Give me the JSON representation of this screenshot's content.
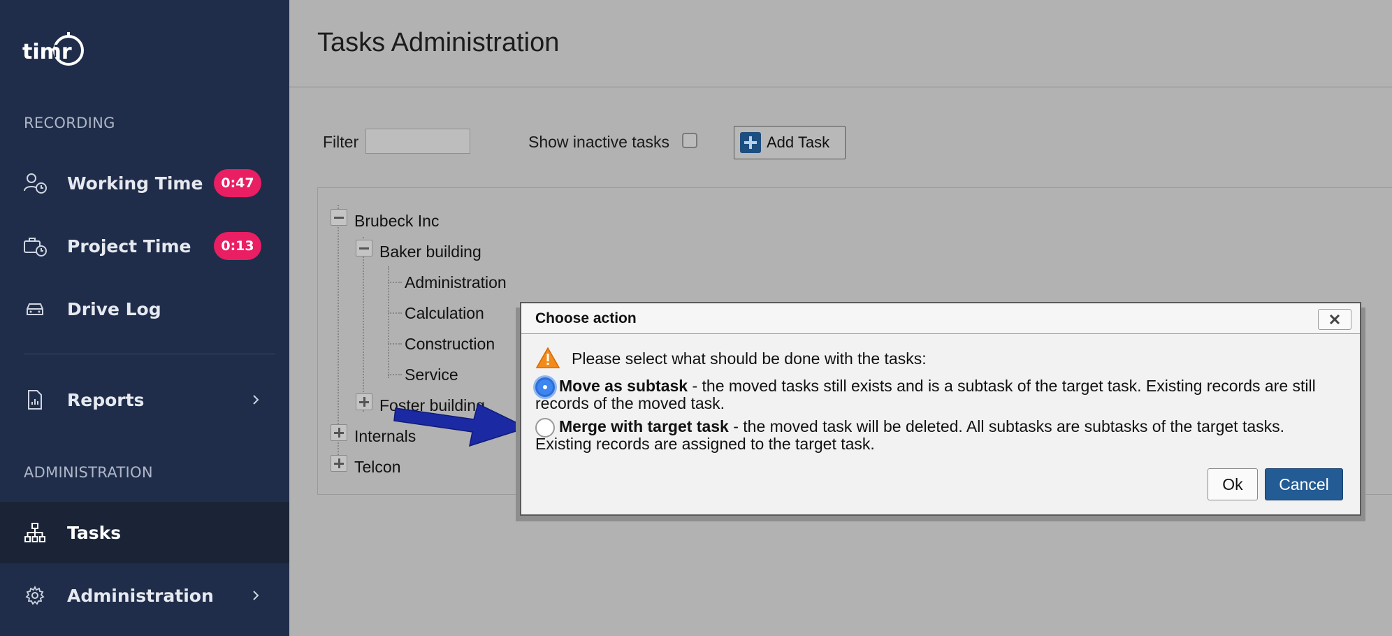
{
  "app": {
    "logo_text": "timr"
  },
  "sidebar": {
    "sections": {
      "recording": "RECORDING",
      "administration": "ADMINISTRATION"
    },
    "items": [
      {
        "label": "Working Time",
        "badge": "0:47",
        "icon": "user-clock-icon"
      },
      {
        "label": "Project Time",
        "badge": "0:13",
        "icon": "briefcase-clock-icon"
      },
      {
        "label": "Drive Log",
        "icon": "car-icon"
      },
      {
        "label": "Reports",
        "icon": "report-icon"
      },
      {
        "label": "Tasks",
        "icon": "hierarchy-icon",
        "active": true
      },
      {
        "label": "Administration",
        "icon": "gear-icon"
      }
    ]
  },
  "main": {
    "title": "Tasks Administration",
    "filter_label": "Filter",
    "filter_value": "",
    "show_inactive_label": "Show inactive tasks",
    "show_inactive_checked": false,
    "add_task_label": "Add Task",
    "tree": [
      {
        "label": "Brubeck Inc",
        "expanded": true
      },
      {
        "label": "Baker building",
        "expanded": true
      },
      {
        "label": "Administration"
      },
      {
        "label": "Calculation"
      },
      {
        "label": "Construction"
      },
      {
        "label": "Service"
      },
      {
        "label": "Foster building",
        "expanded": false
      },
      {
        "label": "Internals",
        "expanded": false
      },
      {
        "label": "Telcon",
        "expanded": false
      }
    ]
  },
  "dialog": {
    "title": "Choose action",
    "prompt": "Please select what should be done with the tasks:",
    "options": [
      {
        "title": "Move as subtask",
        "description": " - the moved tasks still exists and is a subtask of the target task. Existing records are still records of the moved task.",
        "selected": true
      },
      {
        "title": "Merge with target task",
        "description": " - the moved task will be deleted. All subtasks are subtasks of the target tasks. Existing records are assigned to the target task.",
        "selected": false
      }
    ],
    "ok_label": "Ok",
    "cancel_label": "Cancel"
  },
  "colors": {
    "sidebar_bg": "#1f2d4a",
    "badge": "#e91e63",
    "cancel_button": "#235b94",
    "arrow": "#1b2aa3"
  }
}
